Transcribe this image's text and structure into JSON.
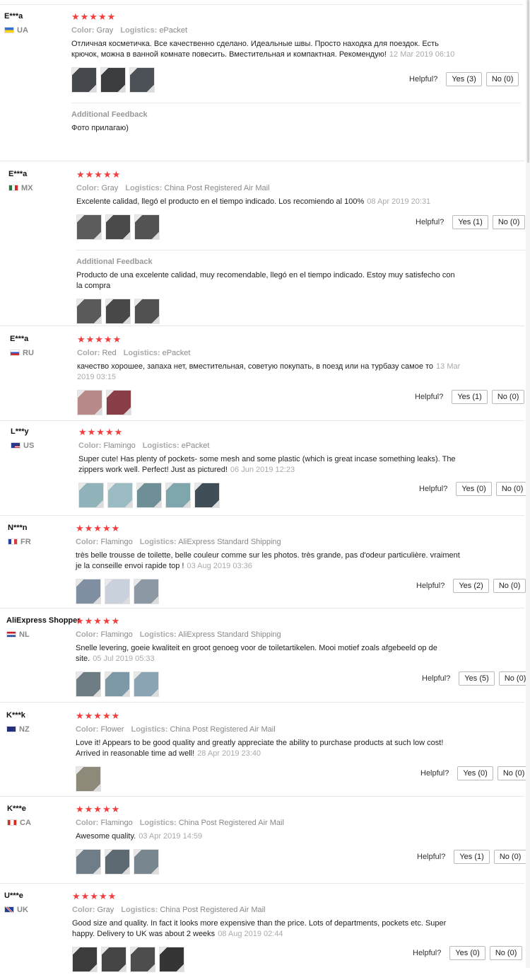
{
  "helpful_label": "Helpful?",
  "color_label": "Color:",
  "logistics_label": "Logistics:",
  "additional_feedback_title": "Additional Feedback",
  "star_color": "#f33e3e",
  "reviews": [
    {
      "user": "E***a",
      "country": "UA",
      "stars": "★★★★★",
      "color": "Gray",
      "logistics": "ePacket",
      "text": "Отличная косметичка. Все качественно сделано. Идеальные швы. Просто находка для поездок. Есть крючок, можна в ванной комнате повесить. Вместительная и компактная. Рекомендую!",
      "date": "12 Mar 2019 06:10",
      "yes": "Yes (3)",
      "no": "No (0)",
      "photos": [
        "#45484d",
        "#3a3c40",
        "#4c5057"
      ],
      "additional": {
        "text": "Фото прилагаю)"
      }
    },
    {
      "user": "E***a",
      "country": "MX",
      "stars": "★★★★★",
      "color": "Gray",
      "logistics": "China Post Registered Air Mail",
      "text": "Excelente calidad, llegó el producto en el tiempo indicado. Los recomiendo al 100%",
      "date": "08 Apr 2019 20:31",
      "yes": "Yes (1)",
      "no": "No (0)",
      "photos": [
        "#5c5c5c",
        "#4a4a4a",
        "#535353"
      ],
      "additional": {
        "text": "Producto de una excelente calidad, muy recomendable, llegó en el tiempo indicado. Estoy muy satisfecho con la compra",
        "photos": [
          "#5a5a5a",
          "#484848",
          "#515151"
        ]
      }
    },
    {
      "user": "E***a",
      "country": "RU",
      "stars": "★★★★★",
      "color": "Red",
      "logistics": "ePacket",
      "text": "качество хорошее, запаха нет, вместительная, советую покупать, в поезд или на турбазу самое то",
      "date": "13 Mar 2019 03:15",
      "yes": "Yes (1)",
      "no": "No (0)",
      "photos": [
        "#b98a8a",
        "#8a3f48"
      ]
    },
    {
      "user": "L***y",
      "country": "US",
      "stars": "★★★★★",
      "color": "Flamingo",
      "logistics": "ePacket",
      "text": "Super cute! Has plenty of pockets- some mesh and some plastic (which is great incase something leaks). The zippers work well. Perfect! Just as pictured!",
      "date": "06 Jun 2019 12:23",
      "yes": "Yes (0)",
      "no": "No (0)",
      "photos": [
        "#8fb3b8",
        "#9cbcc4",
        "#6f8f96",
        "#7fa6ad",
        "#3f4e57"
      ]
    },
    {
      "user": "N***n",
      "country": "FR",
      "stars": "★★★★★",
      "color": "Flamingo",
      "logistics": "AliExpress Standard Shipping",
      "text": "très belle trousse de toilette, belle couleur comme sur les photos. très grande, pas d'odeur particulière. vraiment je la conseille envoi rapide top !",
      "date": "03 Aug 2019 03:36",
      "yes": "Yes (2)",
      "no": "No (0)",
      "photos": [
        "#7f8ea0",
        "#c9d2dc",
        "#8c98a4"
      ]
    },
    {
      "user": "AliExpress Shopper",
      "country": "NL",
      "stars": "★★★★★",
      "color": "Flamingo",
      "logistics": "AliExpress Standard Shipping",
      "text": "Snelle levering, goeie kwaliteit en groot genoeg voor de toiletartikelen. Mooi motief zoals afgebeeld op de site.",
      "date": "05 Jul 2019 05:33",
      "yes": "Yes (5)",
      "no": "No (0)",
      "photos": [
        "#6e7c84",
        "#7d99a8",
        "#8aa4b3"
      ]
    },
    {
      "user": "K***k",
      "country": "NZ",
      "stars": "★★★★★",
      "color": "Flower",
      "logistics": "China Post Registered Air Mail",
      "text": "Love it! Appears to be good quality and greatly appreciate the ability to purchase products at such low cost! Arrived in reasonable time ad well!",
      "date": "28 Apr 2019 23:40",
      "yes": "Yes (0)",
      "no": "No (0)",
      "photos": [
        "#8e8a7a"
      ]
    },
    {
      "user": "K***e",
      "country": "CA",
      "stars": "★★★★★",
      "color": "Flamingo",
      "logistics": "China Post Registered Air Mail",
      "text": "Awesome quality.",
      "date": "03 Apr 2019 14:59",
      "yes": "Yes (1)",
      "no": "No (0)",
      "photos": [
        "#6f7d88",
        "#5e6a72",
        "#788690"
      ]
    },
    {
      "user": "U***e",
      "country": "UK",
      "stars": "★★★★★",
      "color": "Gray",
      "logistics": "China Post Registered Air Mail",
      "text": "Good size and quality. In fact it looks more expensive than the price. Lots of departments, pockets etc. Super happy. Delivery to UK was about 2 weeks",
      "date": "08 Aug 2019 02:44",
      "yes": "Yes (0)",
      "no": "No (0)",
      "photos": [
        "#3c3c3c",
        "#454545",
        "#4d4d4d",
        "#353535"
      ]
    }
  ]
}
